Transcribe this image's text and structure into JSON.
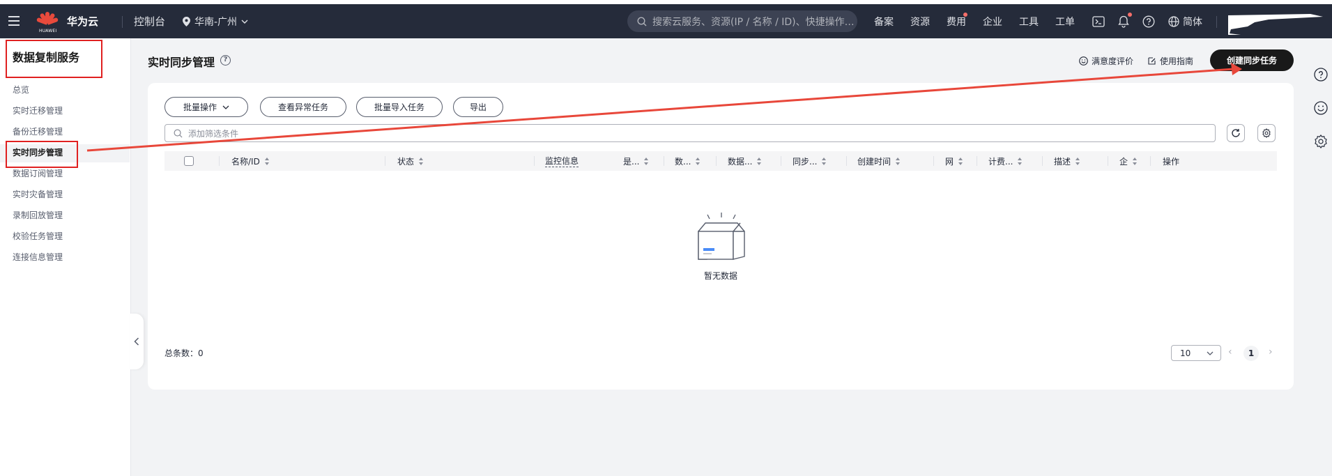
{
  "topbar": {
    "brand": "华为云",
    "logo_text": "HUAWEI",
    "console": "控制台",
    "region": "华南-广州",
    "search_placeholder": "搜索云服务、资源(IP / 名称 / ID)、快捷操作…",
    "nav": [
      "备案",
      "资源",
      "费用",
      "企业",
      "工具",
      "工单"
    ],
    "language": "简体",
    "icons": [
      "menu-icon",
      "location-pin-icon",
      "chevron-down-icon",
      "search-icon",
      "terminal-icon",
      "bell-icon",
      "help-icon",
      "globe-icon"
    ]
  },
  "sidebar": {
    "title": "数据复制服务",
    "items": [
      "总览",
      "实时迁移管理",
      "备份迁移管理",
      "实时同步管理",
      "数据订阅管理",
      "实时灾备管理",
      "录制回放管理",
      "校验任务管理",
      "连接信息管理"
    ],
    "active": "实时同步管理"
  },
  "header": {
    "title": "实时同步管理",
    "satisfaction": "满意度评价",
    "guide": "使用指南",
    "create_button": "创建同步任务"
  },
  "toolbar": {
    "batch_ops": "批量操作",
    "view_abnormal": "查看异常任务",
    "batch_import": "批量导入任务",
    "export": "导出",
    "filter_placeholder": "添加筛选条件"
  },
  "table": {
    "columns": [
      "名称/ID",
      "状态",
      "监控信息",
      "是...",
      "数...",
      "数据...",
      "同步...",
      "创建时间",
      "网",
      "计费...",
      "描述",
      "企",
      "操作"
    ],
    "empty_text": "暂无数据"
  },
  "footer": {
    "total": "总条数：0",
    "page_size": "10",
    "current_page": "1"
  },
  "colors": {
    "topbar_bg": "#252b3a",
    "primary_button": "#191919",
    "annotation_red": "#e02020",
    "notification_dot": "#f66f6a"
  }
}
